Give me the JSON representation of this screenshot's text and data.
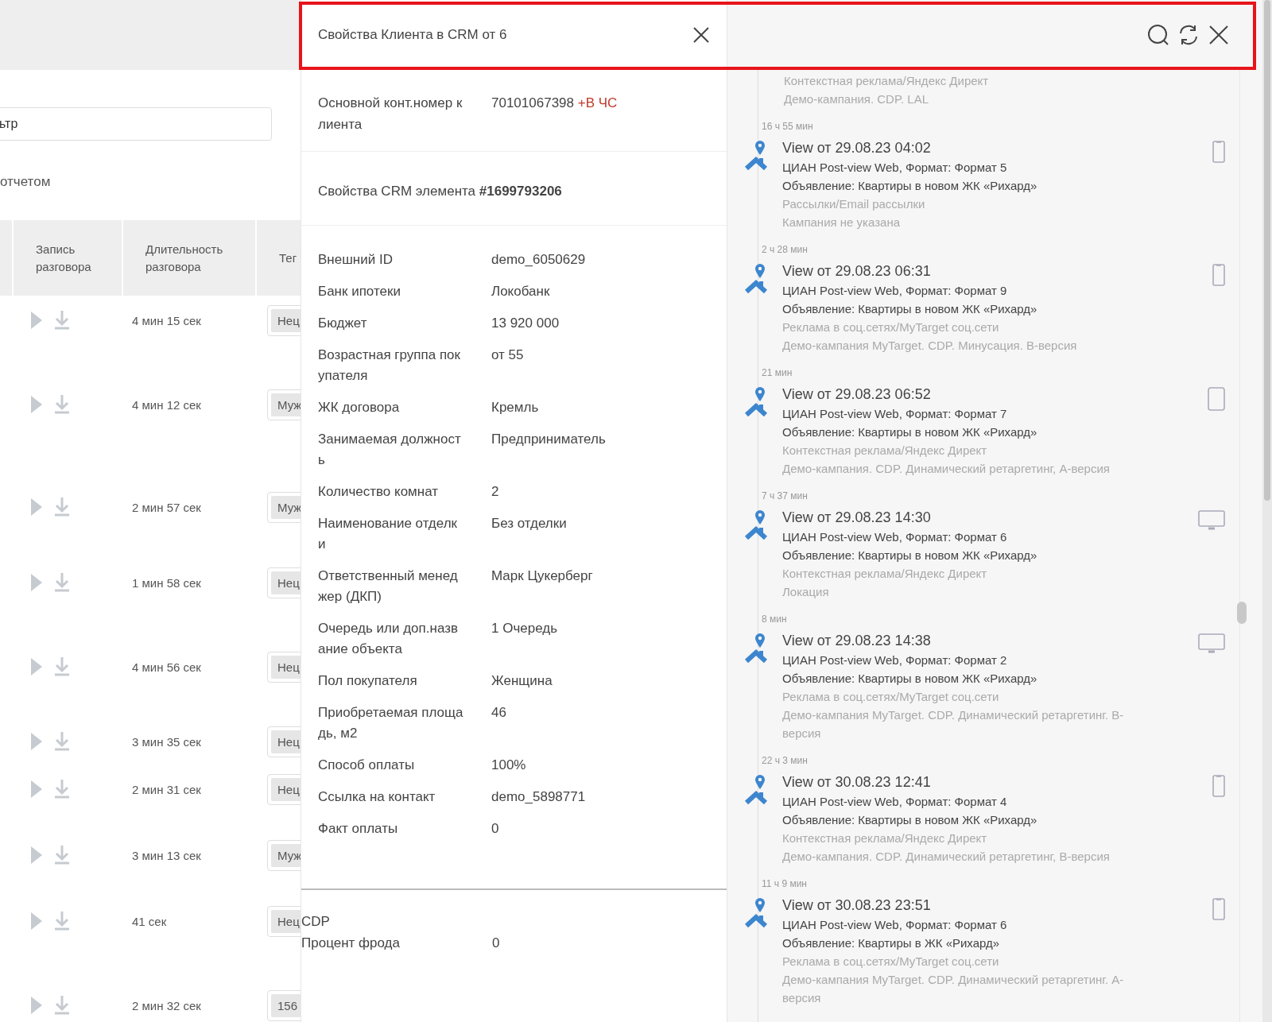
{
  "filter": {
    "value": "ьтр"
  },
  "report_label": "отчетом",
  "calls_table": {
    "columns": [
      "Запись разговора",
      "Длительность разговора",
      "Тег"
    ],
    "rows": [
      {
        "duration": "4 мин 15 сек",
        "tag": "Нец"
      },
      {
        "duration": "4 мин 12 сек",
        "tag": "Муж"
      },
      {
        "duration": "2 мин 57 сек",
        "tag": "Муж"
      },
      {
        "duration": "1 мин 58 сек",
        "tag": "Нец"
      },
      {
        "duration": "4 мин 56 сек",
        "tag": "Нец"
      },
      {
        "duration": "3 мин 35 сек",
        "tag": "Нец"
      },
      {
        "duration": "2 мин 31 сек",
        "tag": "Нец"
      },
      {
        "duration": "3 мин 13 сек",
        "tag": "Муж"
      },
      {
        "duration": "41 сек",
        "tag": "Нец"
      },
      {
        "duration": "2 мин 32 сек",
        "tag": "156"
      }
    ]
  },
  "client_panel": {
    "title": "Свойства Клиента в CRM от 6",
    "contact": {
      "label": "Основной конт.номер клиента",
      "number": "70101067398",
      "flag": "+В ЧС"
    },
    "crm_heading": "Свойства CRM элемента **#1699793206**",
    "properties": [
      {
        "label": "Внешний ID",
        "value": "demo_6050629"
      },
      {
        "label": "Банк ипотеки",
        "value": "Локобанк"
      },
      {
        "label": "Бюджет",
        "value": "13 920 000"
      },
      {
        "label": "Возрастная группа покупателя",
        "value": "от 55"
      },
      {
        "label": "ЖК договора",
        "value": "Кремль"
      },
      {
        "label": "Занимаемая должность",
        "value": "Предприниматель"
      },
      {
        "label": "Количество комнат",
        "value": "2"
      },
      {
        "label": "Наименование отделки",
        "value": "Без отделки"
      },
      {
        "label": "Ответственный менеджер (ДКП)",
        "value": "Марк Цукерберг"
      },
      {
        "label": "Очередь или доп.название объекта",
        "value": "1 Очередь"
      },
      {
        "label": "Пол покупателя",
        "value": "Женщина"
      },
      {
        "label": "Приобретаемая площадь, м2",
        "value": "46"
      },
      {
        "label": "Способ оплаты",
        "value": "100%"
      },
      {
        "label": "Ссылка на контакт",
        "value": "demo_5898771"
      },
      {
        "label": "Факт оплаты",
        "value": "0"
      }
    ],
    "cdp": {
      "heading": "CDP",
      "properties": [
        {
          "label": "Процент фрода",
          "value": "0"
        }
      ]
    }
  },
  "timeline": {
    "partial_entry": {
      "lines": [
        "Контекстная реклама/Яндекс Директ",
        "Демо-кампания. CDP. LAL"
      ]
    },
    "entries": [
      {
        "gap": "16 ч 55 мин",
        "title": "View от 29.08.23 04:02",
        "source": "ЦИАН Post-view Web, Формат: Формат 5",
        "ad": "Объявление: Квартиры в новом ЖК «Рихард»",
        "channel": "Рассылки/Email рассылки",
        "campaign": "Кампания не указана",
        "kind": "mobile"
      },
      {
        "gap": "2 ч 28 мин",
        "title": "View от 29.08.23 06:31",
        "source": "ЦИАН Post-view Web, Формат: Формат 9",
        "ad": "Объявление: Квартиры в новом ЖК «Рихард»",
        "channel": "Реклама в соц.сетях/MyTarget соц.сети",
        "campaign": "Демо-кампания MyTarget. CDP. Минусация. В-версия",
        "kind": "mobile"
      },
      {
        "gap": "21 мин",
        "title": "View от 29.08.23 06:52",
        "source": "ЦИАН Post-view Web, Формат: Формат 7",
        "ad": "Объявление: Квартиры в новом ЖК «Рихард»",
        "channel": "Контекстная реклама/Яндекс Директ",
        "campaign": "Демо-кампания. CDP. Динамический ретаргетинг, А-версия",
        "kind": "tablet"
      },
      {
        "gap": "7 ч 37 мин",
        "title": "View от 29.08.23 14:30",
        "source": "ЦИАН Post-view Web, Формат: Формат 6",
        "ad": "Объявление: Квартиры в новом ЖК «Рихард»",
        "channel": "Контекстная реклама/Яндекс Директ",
        "campaign": "Локация",
        "kind": "desktop"
      },
      {
        "gap": "8 мин",
        "title": "View от 29.08.23 14:38",
        "source": "ЦИАН Post-view Web, Формат: Формат 2",
        "ad": "Объявление: Квартиры в новом ЖК «Рихард»",
        "channel": "Реклама в соц.сетях/MyTarget соц.сети",
        "campaign": "Демо-кампания MyTarget. CDP. Динамический ретаргетинг. В-версия",
        "kind": "desktop"
      },
      {
        "gap": "22 ч 3 мин",
        "title": "View от 30.08.23 12:41",
        "source": "ЦИАН Post-view Web, Формат: Формат 4",
        "ad": "Объявление: Квартиры в новом ЖК «Рихард»",
        "channel": "Контекстная реклама/Яндекс Директ",
        "campaign": "Демо-кампания. CDP. Динамический ретаргетинг, В-версия",
        "kind": "mobile"
      },
      {
        "gap": "11 ч 9 мин",
        "title": "View от 30.08.23 23:51",
        "source": "ЦИАН Post-view Web, Формат: Формат 6",
        "ad": "Объявление: Квартиры в ЖК «Рихард»",
        "channel": "Реклама в соц.сетях/MyTarget соц.сети",
        "campaign": "Демо-кампания MyTarget. CDP. Динамический ретаргетинг. А-версия",
        "kind": "mobile"
      }
    ]
  }
}
